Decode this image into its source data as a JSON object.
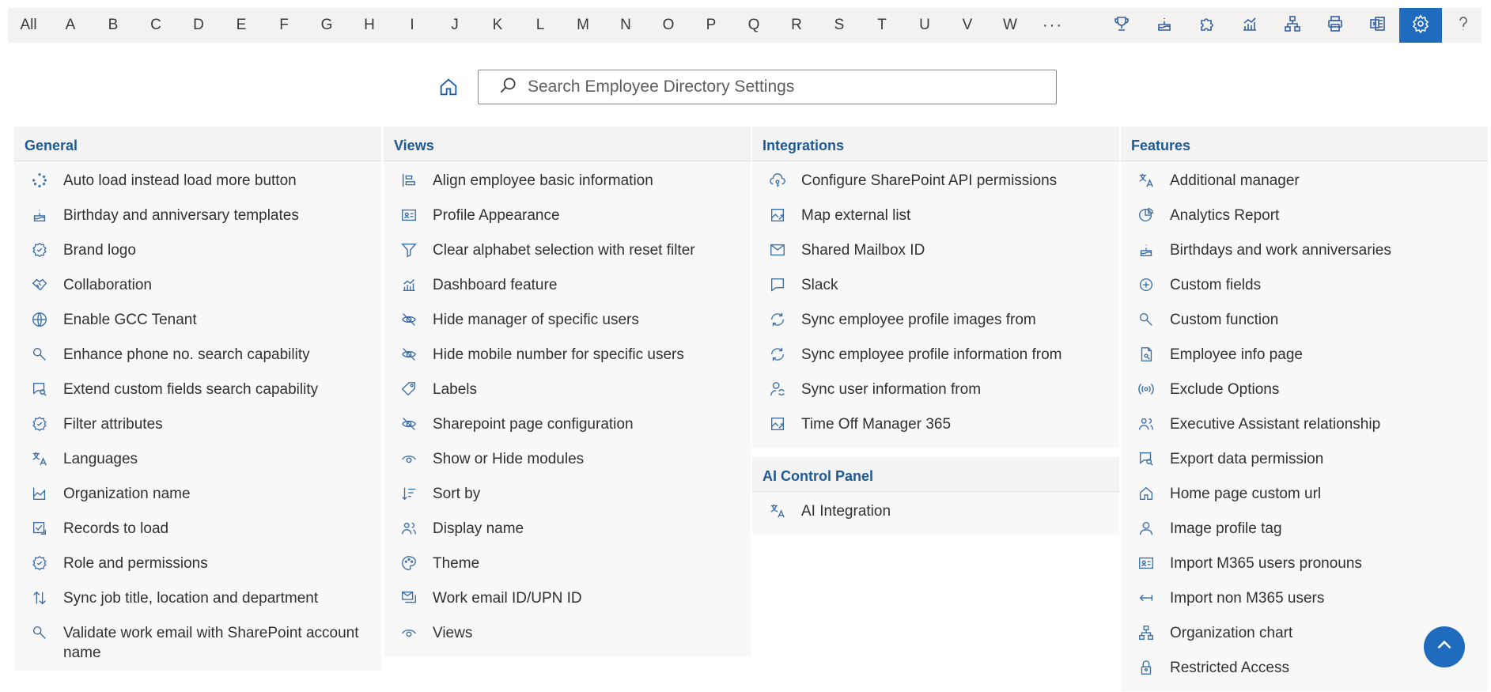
{
  "alphabet": [
    "All",
    "A",
    "B",
    "C",
    "D",
    "E",
    "F",
    "G",
    "H",
    "I",
    "J",
    "K",
    "L",
    "M",
    "N",
    "O",
    "P",
    "Q",
    "R",
    "S",
    "T",
    "U",
    "V",
    "W",
    "···"
  ],
  "toolbar": [
    {
      "icon": "trophy-icon"
    },
    {
      "icon": "cake-icon"
    },
    {
      "icon": "puzzle-icon"
    },
    {
      "icon": "chart-icon"
    },
    {
      "icon": "org-chart-icon"
    },
    {
      "icon": "print-icon"
    },
    {
      "icon": "excel-icon"
    },
    {
      "icon": "gear-icon",
      "active": true
    },
    {
      "icon": "help-icon"
    }
  ],
  "search": {
    "placeholder": "Search Employee Directory Settings"
  },
  "colors": {
    "accent": "#1f6bbd",
    "heading": "#1f5a93",
    "icon": "#3b6fa8"
  },
  "sections": {
    "general": {
      "title": "General",
      "items": [
        {
          "label": "Auto load instead load more button",
          "icon": "loading-icon"
        },
        {
          "label": "Birthday and anniversary templates",
          "icon": "cake-icon"
        },
        {
          "label": "Brand logo",
          "icon": "badge-icon"
        },
        {
          "label": "Collaboration",
          "icon": "handshake-icon"
        },
        {
          "label": "Enable GCC Tenant",
          "icon": "globe-icon"
        },
        {
          "label": "Enhance phone no. search capability",
          "icon": "search-icon"
        },
        {
          "label": "Extend custom fields search capability",
          "icon": "chat-search-icon"
        },
        {
          "label": "Filter attributes",
          "icon": "badge-icon"
        },
        {
          "label": "Languages",
          "icon": "translate-icon"
        },
        {
          "label": "Organization name",
          "icon": "area-chart-icon"
        },
        {
          "label": "Records to load",
          "icon": "checklist-icon"
        },
        {
          "label": "Role and permissions",
          "icon": "badge-icon"
        },
        {
          "label": "Sync job title, location and department",
          "icon": "arrows-updown-icon"
        },
        {
          "label": "Validate work email with SharePoint account name",
          "icon": "search-icon"
        }
      ]
    },
    "views": {
      "title": "Views",
      "items": [
        {
          "label": "Align employee basic information",
          "icon": "align-left-icon"
        },
        {
          "label": "Profile Appearance",
          "icon": "contact-card-icon"
        },
        {
          "label": "Clear alphabet selection with reset filter",
          "icon": "filter-icon"
        },
        {
          "label": "Dashboard feature",
          "icon": "chart-icon"
        },
        {
          "label": "Hide manager of specific users",
          "icon": "eye-hide-icon"
        },
        {
          "label": "Hide mobile number for specific users",
          "icon": "eye-hide-icon"
        },
        {
          "label": "Labels",
          "icon": "tag-icon"
        },
        {
          "label": "Sharepoint page configuration",
          "icon": "eye-hide-icon"
        },
        {
          "label": "Show or Hide modules",
          "icon": "eye-icon"
        },
        {
          "label": "Sort by",
          "icon": "sort-icon"
        },
        {
          "label": "Display name",
          "icon": "people-icon"
        },
        {
          "label": "Theme",
          "icon": "palette-icon"
        },
        {
          "label": "Work email ID/UPN ID",
          "icon": "mail-stack-icon"
        },
        {
          "label": "Views",
          "icon": "eye-icon"
        }
      ]
    },
    "integrations": {
      "title": "Integrations",
      "items": [
        {
          "label": "Configure SharePoint API permissions",
          "icon": "cloud-key-icon"
        },
        {
          "label": "Map external list",
          "icon": "image-link-icon"
        },
        {
          "label": "Shared Mailbox ID",
          "icon": "mail-icon"
        },
        {
          "label": "Slack",
          "icon": "chat-icon"
        },
        {
          "label": "Sync employee profile images from",
          "icon": "sync-icon"
        },
        {
          "label": "Sync employee profile information from",
          "icon": "sync-icon"
        },
        {
          "label": "Sync user information from",
          "icon": "person-sync-icon"
        },
        {
          "label": "Time Off Manager 365",
          "icon": "image-link-icon"
        }
      ]
    },
    "ai": {
      "title": "AI Control Panel",
      "items": [
        {
          "label": "AI Integration",
          "icon": "translate-icon"
        }
      ]
    },
    "features": {
      "title": "Features",
      "items": [
        {
          "label": "Additional manager",
          "icon": "translate-icon"
        },
        {
          "label": "Analytics Report",
          "icon": "analytics-icon"
        },
        {
          "label": "Birthdays and work anniversaries",
          "icon": "cake-icon"
        },
        {
          "label": "Custom fields",
          "icon": "add-circle-icon"
        },
        {
          "label": "Custom function",
          "icon": "search-icon"
        },
        {
          "label": "Employee info page",
          "icon": "document-icon"
        },
        {
          "label": "Exclude Options",
          "icon": "broadcast-icon"
        },
        {
          "label": "Executive Assistant relationship",
          "icon": "people-icon"
        },
        {
          "label": "Export data permission",
          "icon": "chat-search-icon"
        },
        {
          "label": "Home page custom url",
          "icon": "home-icon"
        },
        {
          "label": "Image profile tag",
          "icon": "person-icon"
        },
        {
          "label": "Import M365 users pronouns",
          "icon": "contact-card-icon"
        },
        {
          "label": "Import non M365 users",
          "icon": "arrow-import-icon"
        },
        {
          "label": "Organization chart",
          "icon": "org-chart-icon"
        },
        {
          "label": "Restricted Access",
          "icon": "lock-person-icon"
        }
      ]
    }
  }
}
